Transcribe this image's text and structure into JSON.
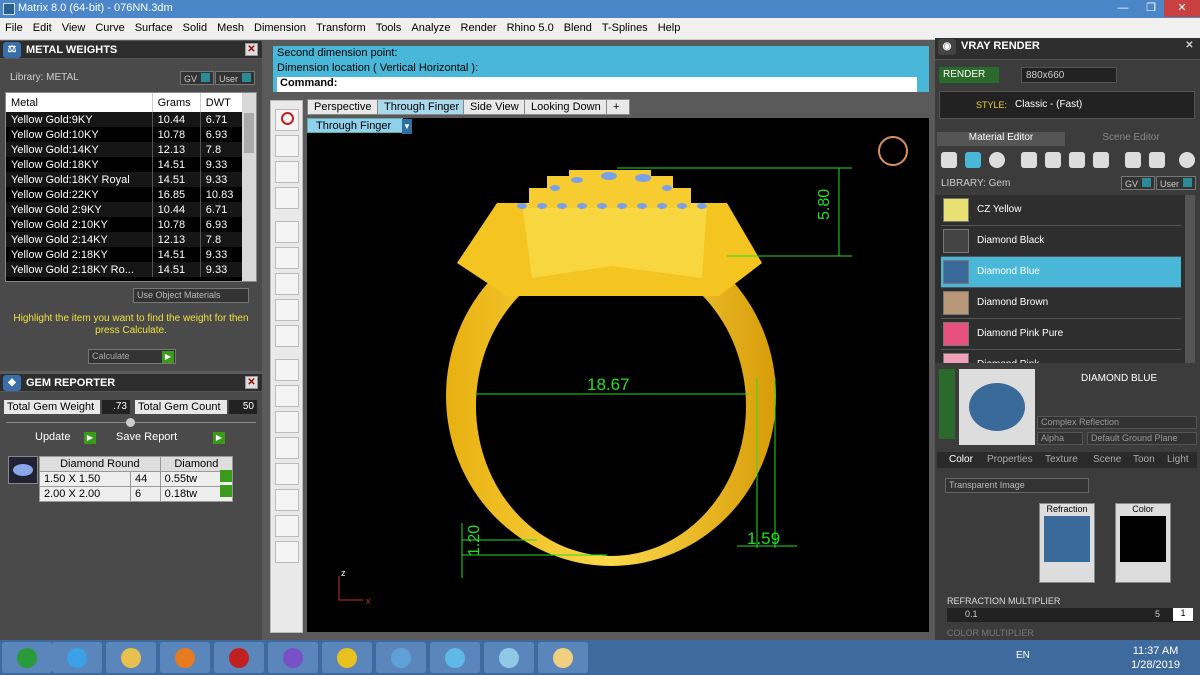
{
  "window": {
    "title": "Matrix 8.0 (64-bit) - 076NN.3dm",
    "min_glyph": "—",
    "max_glyph": "❐",
    "close_glyph": "✕"
  },
  "menu": [
    "File",
    "Edit",
    "View",
    "Curve",
    "Surface",
    "Solid",
    "Mesh",
    "Dimension",
    "Transform",
    "Tools",
    "Analyze",
    "Render",
    "Rhino 5.0",
    "Blend",
    "T-Splines",
    "Help"
  ],
  "metal_weights": {
    "title": "METAL WEIGHTS",
    "library_label": "Library: METAL",
    "gv_label": "GV",
    "user_label": "User",
    "columns": [
      "Metal",
      "Grams",
      "DWT"
    ],
    "rows": [
      [
        "Yellow Gold:9KY",
        "10.44",
        "6.71"
      ],
      [
        "Yellow Gold:10KY",
        "10.78",
        "6.93"
      ],
      [
        "Yellow Gold:14KY",
        "12.13",
        "7.8"
      ],
      [
        "Yellow Gold:18KY",
        "14.51",
        "9.33"
      ],
      [
        "Yellow Gold:18KY Royal",
        "14.51",
        "9.33"
      ],
      [
        "Yellow Gold:22KY",
        "16.85",
        "10.83"
      ],
      [
        "Yellow Gold 2:9KY",
        "10.44",
        "6.71"
      ],
      [
        "Yellow Gold 2:10KY",
        "10.78",
        "6.93"
      ],
      [
        "Yellow Gold 2:14KY",
        "12.13",
        "7.8"
      ],
      [
        "Yellow Gold 2:18KY",
        "14.51",
        "9.33"
      ],
      [
        "Yellow Gold 2:18KY Ro...",
        "14.51",
        "9.33"
      ]
    ],
    "use_object_materials": "Use Object Materials",
    "hint": "Highlight the item you want to find the weight for then press Calculate.",
    "calculate": "Calculate"
  },
  "gem_reporter": {
    "title": "GEM REPORTER",
    "total_gem_weight_label": "Total Gem Weight",
    "total_gem_weight": ".73",
    "total_gem_count_label": "Total Gem Count",
    "total_gem_count": "50",
    "update": "Update",
    "save_report": "Save Report",
    "table_header": [
      "Diamond Round",
      "Diamond"
    ],
    "rows": [
      [
        "1.50 X 1.50",
        "44",
        "0.55tw"
      ],
      [
        "2.00 X 2.00",
        "6",
        "0.18tw"
      ]
    ]
  },
  "command": {
    "line1": "Second dimension point:",
    "line2": "Dimension location ( Vertical  Horizontal ):",
    "prompt": "Command:"
  },
  "viewport": {
    "tabs": [
      "Perspective",
      "Through Finger",
      "Side View",
      "Looking Down"
    ],
    "add_tab": "+",
    "active_label": "Through Finger",
    "dims": {
      "height": "5.80",
      "inner": "18.67",
      "bottom": "1.20",
      "side": "1.59"
    },
    "axis_z": "z",
    "axis_x": "x"
  },
  "vray": {
    "title": "VRAY RENDER",
    "render": "RENDER",
    "resolution": "880x660",
    "style_label": "STYLE:",
    "style_value": "Classic - (Fast)",
    "tab_material": "Material Editor",
    "tab_scene": "Scene Editor",
    "library": "LIBRARY: Gem",
    "gv_label": "GV",
    "user_label": "User",
    "materials": [
      {
        "name": "CZ Yellow",
        "color": "#e8e070"
      },
      {
        "name": "Diamond Black",
        "color": "#444"
      },
      {
        "name": "Diamond Blue",
        "color": "#3a6a9a"
      },
      {
        "name": "Diamond Brown",
        "color": "#b89878"
      },
      {
        "name": "Diamond Pink Pure",
        "color": "#e85080"
      },
      {
        "name": "Diamond Pink",
        "color": "#f0a0b8"
      }
    ],
    "selected_name": "DIAMOND BLUE",
    "reflection": "Complex Reflection",
    "alpha": "Alpha",
    "ground": "Default Ground Plane",
    "tabs2": [
      "Color",
      "Properties",
      "Texture",
      "Scene",
      "Toon",
      "Light"
    ],
    "transparent": "Transparent Image",
    "refraction": "Refraction",
    "color": "Color",
    "refr_mult": "REFRACTION MULTIPLIER",
    "refr_min": "0.1",
    "refr_max": "5",
    "refr_val": "1",
    "color_mult": "COLOR MULTIPLIER"
  },
  "taskbar": {
    "lang": "EN",
    "time": "11:37 AM",
    "date": "1/28/2019",
    "apps": [
      {
        "name": "start-button",
        "color": "#2a9a3a"
      },
      {
        "name": "ie",
        "color": "#3aa0e8"
      },
      {
        "name": "explorer",
        "color": "#e8c050"
      },
      {
        "name": "media",
        "color": "#e87a20"
      },
      {
        "name": "app-red",
        "color": "#c02020"
      },
      {
        "name": "viber",
        "color": "#7a50c8"
      },
      {
        "name": "chrome",
        "color": "#e8c020"
      },
      {
        "name": "app-blue",
        "color": "#60a0d8"
      },
      {
        "name": "matrix",
        "color": "#60b8e8"
      },
      {
        "name": "app-box",
        "color": "#90c8e8"
      },
      {
        "name": "paint",
        "color": "#f0d080"
      }
    ]
  }
}
